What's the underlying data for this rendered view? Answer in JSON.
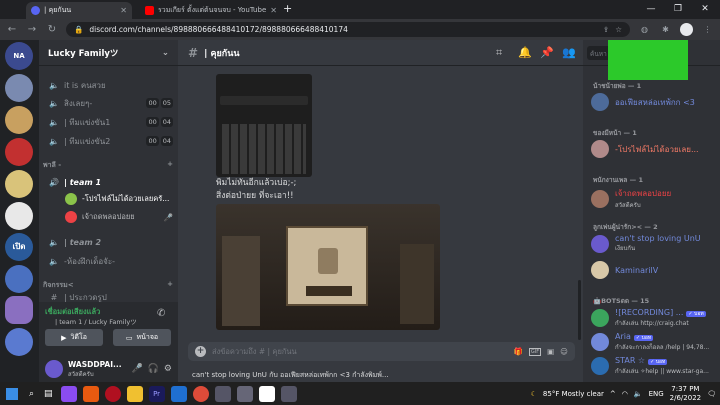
{
  "browser": {
    "tabs": [
      {
        "title": "| คุยกันน",
        "color": "#5865f2"
      },
      {
        "title": "รวมเกียร์ ตั้งแต่ต้นจนจบ - YouTube",
        "color": "#ff0000"
      }
    ],
    "new_tab": "+",
    "url": "discord.com/channels/898880666488410172/898880666488410174"
  },
  "server": {
    "name": "Lucky Familyツ",
    "channels": [
      {
        "name": "it is คนสวย",
        "type": "voice"
      },
      {
        "name": "สิงเลยๆ-",
        "type": "voice",
        "count": [
          "00",
          "05"
        ]
      },
      {
        "name": "| ทีมแข่งขัน1",
        "type": "voice",
        "count": [
          "00",
          "04"
        ]
      },
      {
        "name": "| ทีมแข่งขัน2",
        "type": "voice",
        "count": [
          "00",
          "04"
        ]
      }
    ],
    "category_1": "พาลี -",
    "channels_2": [
      {
        "name": "| team 1",
        "type": "voice"
      },
      {
        "name": "| team 2",
        "type": "voice"
      },
      {
        "name": "-ห้องฝึกเด็อจัะ-",
        "type": "voice"
      }
    ],
    "voice_users": [
      {
        "name": "-โปรไฟล์ไม่ได้อวยเลยครั..."
      },
      {
        "name": "เจ้าถดพลอปอยย"
      }
    ],
    "category_2": "กิจกรรม<",
    "category_2_item": "| ประกวดรูป"
  },
  "voice_connection": {
    "status": "เชื่อมต่อเสียงแล้ว",
    "channel": "| team 1 / Lucky Familyツ",
    "video_button": "วิดีโอ",
    "screen_button": "หน้าจอ"
  },
  "user": {
    "name": "WASDDPAI...",
    "status": "สวัสดีครับ"
  },
  "chat": {
    "channel_name": "| คุยกันน",
    "messages": [
      "พิมไม่ทันอีกแล้วเบ่อ;-;",
      "สิ่งต่อป่ายย ที่จะเอา!!"
    ],
    "composer_placeholder": "ส่งข้อความถึง # | คุยกันน",
    "typing": "can't stop loving UnU กับ ออเฟียสหล่อเทพ้กก <3 กำลังพิมพ์..."
  },
  "members": {
    "search_placeholder": "ค้นหา",
    "groups": [
      {
        "label": "น้าชน้ายพ่อ — 1"
      },
      {
        "label": "ของมีหน้า — 1"
      },
      {
        "label": "พนักงานเพล — 1"
      },
      {
        "label": "ลูกเพ่นผู้น่ารัก>< — 2"
      },
      {
        "label": "🤖BOTSดด — 15"
      }
    ],
    "list": [
      {
        "name": "ออเฟียสหล่อเทพ้กก <3",
        "status": "",
        "color": "#7289da"
      },
      {
        "name": "-โปรไฟล์ไม่ได้อวยเลย...",
        "status": "",
        "color": "#f47b67"
      },
      {
        "name": "เจ้าถดพลอปอยย",
        "status": "สวัสดีครับ",
        "color": "#ed4245"
      },
      {
        "name": "can't stop loving UnU",
        "status": "เงียบกัน",
        "color": "#7289da"
      },
      {
        "name": "KaminarilV",
        "status": "",
        "color": "#7289da"
      },
      {
        "name": "![RECORDING] ...",
        "status": "กำลังเล่น http://craig.chat",
        "color": "#7289da",
        "badge": "✓ บอท"
      },
      {
        "name": "Aria",
        "status": "กำลังจะกาลงก็อลล /help | 94,78...",
        "color": "#7289da",
        "badge": "✓ บอท"
      },
      {
        "name": "STAR ☆",
        "status": "กำลังเล่น ✧help || www.star-ga...",
        "color": "#7289da",
        "badge": "✓ บอท"
      }
    ]
  },
  "taskbar": {
    "weather": "85°F  Mostly clear",
    "lang": "ENG",
    "time": "7:37 PM",
    "date": "2/6/2022"
  }
}
